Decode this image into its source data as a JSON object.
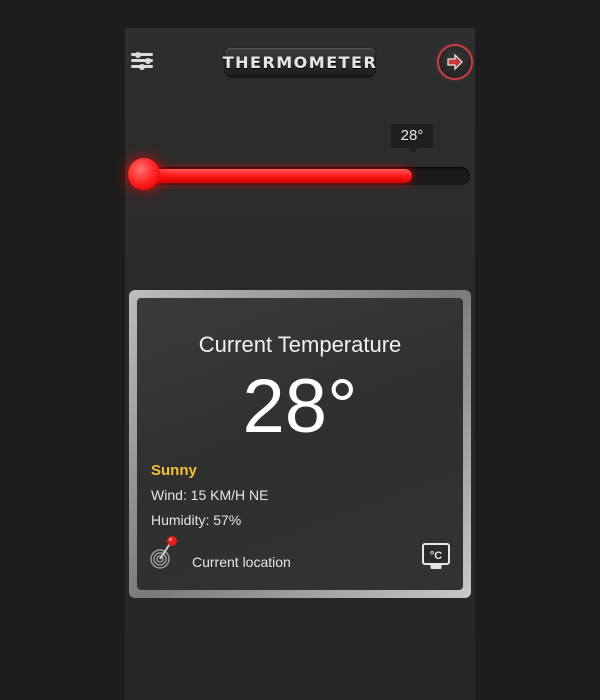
{
  "header": {
    "title": "THERMOMETER"
  },
  "slider": {
    "value_label": "28°",
    "fill_fraction": 0.83,
    "accent": "#ff1a1a"
  },
  "card": {
    "title": "Current Temperature",
    "temperature": "28°",
    "condition": "Sunny",
    "condition_color": "#f2c036",
    "wind": "Wind: 15 KM/H NE",
    "humidity": "Humidity: 57%",
    "location": "Current location",
    "unit": "°C"
  },
  "icons": [
    "settings-sliders-icon",
    "next-arrow-icon",
    "location-pin-icon",
    "celsius-unit-icon"
  ]
}
